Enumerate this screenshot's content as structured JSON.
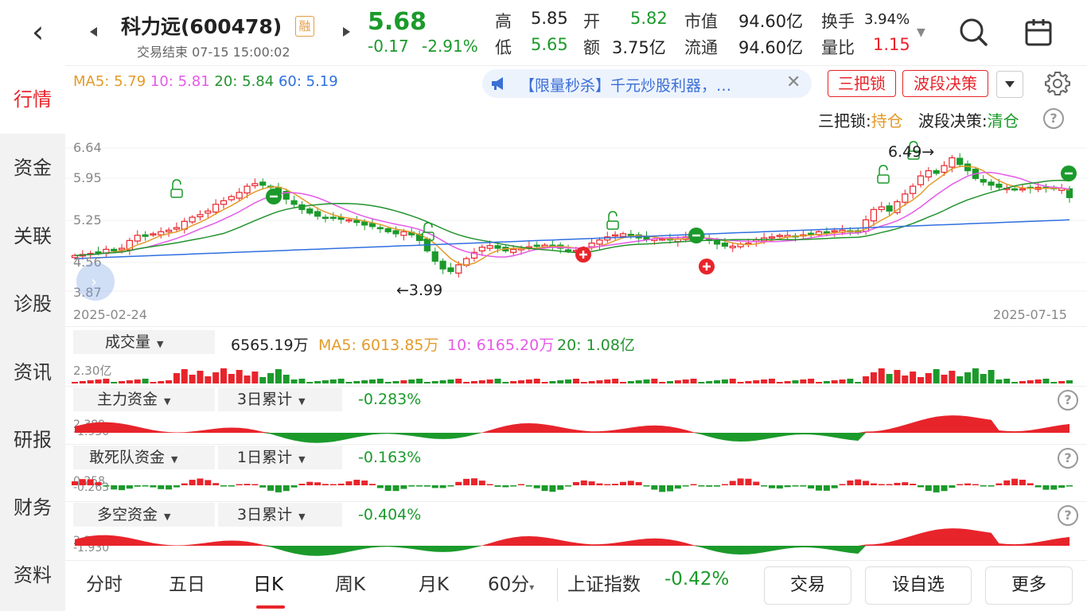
{
  "header": {
    "stock_name": "科力远(600478)",
    "margin_tag": "融",
    "status": "交易结束 07-15 15:00:02",
    "price": "5.68",
    "change": "-0.17",
    "change_pct": "-2.91%",
    "quotes": {
      "high_label": "高",
      "high": "5.85",
      "low_label": "低",
      "low": "5.65",
      "open_label": "开",
      "open": "5.82",
      "amount_label": "额",
      "amount": "3.75亿",
      "mktcap_label": "市值",
      "mktcap": "94.60亿",
      "float_label": "流通",
      "float": "94.60亿",
      "turnover_label": "换手",
      "turnover": "3.94%",
      "volratio_label": "量比",
      "volratio": "1.15"
    }
  },
  "sidebar": {
    "items": [
      {
        "label": "行情",
        "active": true
      },
      {
        "label": "资金"
      },
      {
        "label": "关联"
      },
      {
        "label": "诊股"
      },
      {
        "label": "资讯"
      },
      {
        "label": "研报"
      },
      {
        "label": "财务"
      },
      {
        "label": "资料"
      }
    ]
  },
  "ma": {
    "ma5": "MA5: 5.79",
    "ma10": "10: 5.81",
    "ma20": "20: 5.84",
    "ma60": "60: 5.19"
  },
  "news": {
    "text": "【限量秒杀】千元炒股利器，…",
    "close": "✕"
  },
  "tools": {
    "btn1": "三把锁",
    "btn2": "波段决策",
    "signal_label1": "三把锁:",
    "signal_value1": "持仓",
    "signal_label2": "波段决策:",
    "signal_value2": "清仓"
  },
  "price_chart": {
    "y_top": "6.64",
    "y_mid1": "5.95",
    "y_mid2": "5.25",
    "y_mid3": "4.56",
    "y_bottom": "3.87",
    "max_label": "6.49→",
    "min_label": "←3.99",
    "date_start": "2025-02-24",
    "date_end": "2025-07-15"
  },
  "volume": {
    "selector": "成交量",
    "value": "6565.19万",
    "ma5": "MA5: 6013.85万",
    "ma10": "10: 6165.20万",
    "ma20": "20: 1.08亿",
    "axis_max": "2.30亿"
  },
  "fund1": {
    "selector": "主力资金",
    "period": "3日累计",
    "value": "-0.283%",
    "axis_top": "2.389",
    "axis_bottom": "-1.930"
  },
  "fund2": {
    "selector": "敢死队资金",
    "period": "1日累计",
    "value": "-0.163%",
    "axis_top": "0.258",
    "axis_bottom": "-0.263"
  },
  "fund3": {
    "selector": "多空资金",
    "period": "3日累计",
    "value": "-0.404%",
    "axis_top": "2.389",
    "axis_bottom": "-1.930"
  },
  "bottom": {
    "tabs": [
      "分时",
      "五日",
      "日K",
      "周K",
      "月K",
      "60分"
    ],
    "active_tab": "日K",
    "index_name": "上证指数",
    "index_change": "-0.42%",
    "trade": "交易",
    "watch": "设自选",
    "more": "更多"
  },
  "colors": {
    "up": "#e8242b",
    "down": "#1b9a2b",
    "ma5": "#e39b2a",
    "ma10": "#e55ae8",
    "ma20": "#23932e",
    "ma60": "#2f6fe0"
  },
  "chart_data": {
    "type": "candlestick",
    "ylim": [
      3.87,
      6.64
    ],
    "y_ticks": [
      "6.64",
      "5.95",
      "5.25",
      "4.56",
      "3.87"
    ],
    "close": [
      4.56,
      4.58,
      4.6,
      4.62,
      4.68,
      4.65,
      4.7,
      4.85,
      4.95,
      4.93,
      4.98,
      5.02,
      5.05,
      5.1,
      5.22,
      5.3,
      5.35,
      5.42,
      5.55,
      5.62,
      5.7,
      5.78,
      5.9,
      5.95,
      5.92,
      5.88,
      5.78,
      5.65,
      5.55,
      5.45,
      5.38,
      5.32,
      5.3,
      5.28,
      5.26,
      5.25,
      5.2,
      5.15,
      5.12,
      5.08,
      5.02,
      4.98,
      5.02,
      4.96,
      4.85,
      4.65,
      4.45,
      4.3,
      4.25,
      4.38,
      4.5,
      4.62,
      4.72,
      4.75,
      4.7,
      4.65,
      4.68,
      4.7,
      4.73,
      4.75,
      4.76,
      4.74,
      4.7,
      4.66,
      4.66,
      4.7,
      4.8,
      4.86,
      4.92,
      4.96,
      4.98,
      4.95,
      4.9,
      4.87,
      4.88,
      4.88,
      4.86,
      4.88,
      4.92,
      4.94,
      4.9,
      4.85,
      4.78,
      4.74,
      4.74,
      4.78,
      4.8,
      4.86,
      4.9,
      4.92,
      4.95,
      4.95,
      4.93,
      4.96,
      4.98,
      5.02,
      5.0,
      5.04,
      5.05,
      5.03,
      5.0,
      5.25,
      5.45,
      5.5,
      5.42,
      5.6,
      5.75,
      5.9,
      6.1,
      6.2,
      6.15,
      6.3,
      6.45,
      6.32,
      6.2,
      6.05,
      5.98,
      5.92,
      5.88,
      5.86,
      5.84,
      5.85,
      5.86,
      5.88,
      5.86,
      5.85,
      5.86,
      5.68
    ],
    "ma_lines": [
      {
        "name": "MA5",
        "values_source": "computed from close"
      },
      {
        "name": "10",
        "values_source": "computed from close"
      },
      {
        "name": "20",
        "values_source": "computed from close"
      },
      {
        "name": "60",
        "values_source": "computed from close"
      }
    ]
  }
}
